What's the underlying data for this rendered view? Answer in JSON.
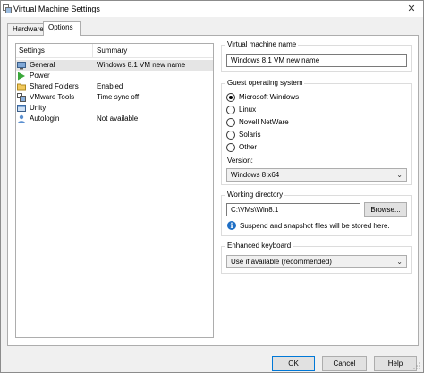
{
  "window": {
    "title": "Virtual Machine Settings"
  },
  "tabs": [
    {
      "label": "Hardware",
      "active": false
    },
    {
      "label": "Options",
      "active": true
    }
  ],
  "settings_list": {
    "headers": {
      "settings": "Settings",
      "summary": "Summary"
    },
    "rows": [
      {
        "name": "General",
        "summary": "Windows 8.1 VM new name",
        "icon": "general-icon",
        "selected": true
      },
      {
        "name": "Power",
        "summary": "",
        "icon": "power-icon",
        "selected": false
      },
      {
        "name": "Shared Folders",
        "summary": "Enabled",
        "icon": "shared-folders-icon",
        "selected": false
      },
      {
        "name": "VMware Tools",
        "summary": "Time sync off",
        "icon": "vmware-tools-icon",
        "selected": false
      },
      {
        "name": "Unity",
        "summary": "",
        "icon": "unity-icon",
        "selected": false
      },
      {
        "name": "Autologin",
        "summary": "Not available",
        "icon": "autologin-icon",
        "selected": false
      }
    ]
  },
  "vm_name": {
    "label": "Virtual machine name",
    "value": "Windows 8.1 VM new name"
  },
  "guest_os": {
    "label": "Guest operating system",
    "options": [
      {
        "label": "Microsoft Windows",
        "checked": true
      },
      {
        "label": "Linux",
        "checked": false
      },
      {
        "label": "Novell NetWare",
        "checked": false
      },
      {
        "label": "Solaris",
        "checked": false
      },
      {
        "label": "Other",
        "checked": false
      }
    ],
    "version_label": "Version:",
    "version_value": "Windows 8 x64"
  },
  "working_dir": {
    "label": "Working directory",
    "value": "C:\\VMs\\Win8.1",
    "browse": "Browse...",
    "note": "Suspend and snapshot files will be stored here."
  },
  "enhanced_keyboard": {
    "label": "Enhanced keyboard",
    "value": "Use if available (recommended)"
  },
  "footer": {
    "ok": "OK",
    "cancel": "Cancel",
    "help": "Help"
  },
  "colors": {
    "accent": "#0078d7",
    "selection": "#e5e5e5",
    "info": "#1f6fc5"
  }
}
